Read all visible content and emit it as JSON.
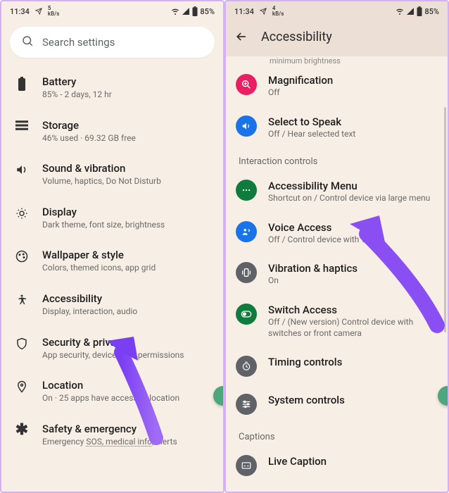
{
  "status": {
    "time": "11:34",
    "speed_value": "5",
    "speed_unit": "kB/s",
    "speed_value2": "4",
    "battery": "85%"
  },
  "left": {
    "search_placeholder": "Search settings",
    "items": [
      {
        "title": "Battery",
        "sub": "85% - 2 days, 12 hr"
      },
      {
        "title": "Storage",
        "sub": "46% used · 69.32 GB free"
      },
      {
        "title": "Sound & vibration",
        "sub": "Volume, haptics, Do Not Disturb"
      },
      {
        "title": "Display",
        "sub": "Dark theme, font size, brightness"
      },
      {
        "title": "Wallpaper & style",
        "sub": "Colors, themed icons, app grid"
      },
      {
        "title": "Accessibility",
        "sub": "Display, interaction, audio"
      },
      {
        "title": "Security & privacy",
        "sub": "App security, device lock, permissions"
      },
      {
        "title": "Location",
        "sub": "On · 25 apps have access to location"
      },
      {
        "title": "Safety & emergency",
        "sub": "Emergency SOS, medical info, alerts"
      }
    ]
  },
  "right": {
    "page_title": "Accessibility",
    "scroll_ghost": "minimum brightness",
    "section_interaction": "Interaction controls",
    "section_captions": "Captions",
    "items_top": [
      {
        "title": "Magnification",
        "sub": "Off",
        "color": "c-pink"
      },
      {
        "title": "Select to Speak",
        "sub": "Off / Hear selected text",
        "color": "c-blue"
      }
    ],
    "items_interaction": [
      {
        "title": "Accessibility Menu",
        "sub": "Shortcut on / Control device via large menu",
        "color": "c-green"
      },
      {
        "title": "Voice Access",
        "sub": "Off / Control device with voice",
        "color": "c-blue"
      },
      {
        "title": "Vibration & haptics",
        "sub": "On",
        "color": "c-grey"
      },
      {
        "title": "Switch Access",
        "sub": "Off / (New version) Control device with switches or front camera",
        "color": "c-green"
      },
      {
        "title": "Timing controls",
        "sub": "",
        "color": "c-grey"
      },
      {
        "title": "System controls",
        "sub": "",
        "color": "c-grey"
      }
    ],
    "items_captions": [
      {
        "title": "Live Caption",
        "sub": "",
        "color": "c-grey"
      }
    ]
  }
}
